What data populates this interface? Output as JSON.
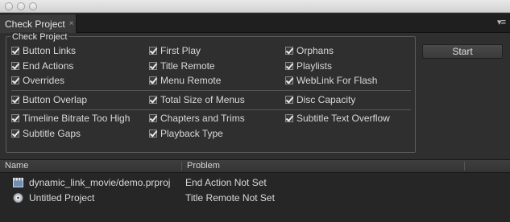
{
  "window": {
    "traffic_lights": [
      "close",
      "minimize",
      "zoom"
    ]
  },
  "tab": {
    "label": "Check Project",
    "close_symbol": "×",
    "menu_symbol": "▾≡"
  },
  "group": {
    "legend": "Check Project",
    "checks": [
      {
        "label": "Button Links",
        "checked": true
      },
      {
        "label": "First Play",
        "checked": true
      },
      {
        "label": "Orphans",
        "checked": true
      },
      {
        "label": "End Actions",
        "checked": true
      },
      {
        "label": "Title Remote",
        "checked": true
      },
      {
        "label": "Playlists",
        "checked": true
      },
      {
        "label": "Overrides",
        "checked": true
      },
      {
        "label": "Menu Remote",
        "checked": true
      },
      {
        "label": "WebLink For Flash",
        "checked": true
      },
      {
        "label": "Button Overlap",
        "checked": true
      },
      {
        "label": "Total Size of Menus",
        "checked": true
      },
      {
        "label": "Disc Capacity",
        "checked": true
      },
      {
        "label": "Timeline Bitrate Too High",
        "checked": true
      },
      {
        "label": "Chapters and Trims",
        "checked": true
      },
      {
        "label": "Subtitle Text Overflow",
        "checked": true
      },
      {
        "label": "Subtitle Gaps",
        "checked": true
      },
      {
        "label": "Playback Type",
        "checked": true
      }
    ]
  },
  "start_label": "Start",
  "table": {
    "columns": [
      "Name",
      "Problem"
    ],
    "rows": [
      {
        "name": "dynamic_link_movie/demo.prproj",
        "problem": "End Action Not Set",
        "icon": "movie-clip-icon"
      },
      {
        "name": "Untitled Project",
        "problem": "Title Remote Not Set",
        "icon": "disc-icon"
      }
    ]
  }
}
